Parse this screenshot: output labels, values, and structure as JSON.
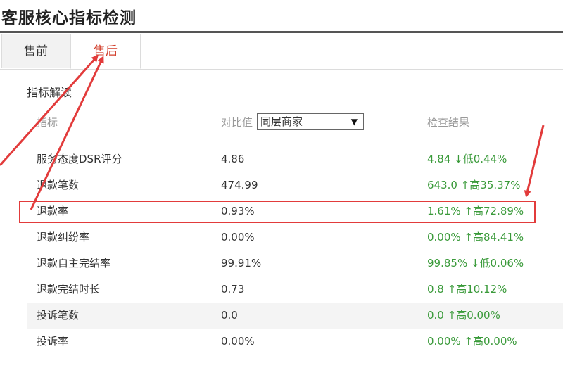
{
  "page": {
    "title": "客服核心指标检测"
  },
  "tabs": [
    {
      "label": "售前",
      "active": false
    },
    {
      "label": "售后",
      "active": true
    }
  ],
  "section": {
    "title": "指标解读",
    "headers": {
      "metric": "指标",
      "compare": "对比值",
      "result": "检查结果"
    },
    "compare_select": {
      "selected": "同层商家"
    }
  },
  "rows": [
    {
      "metric": "服务态度DSR评分",
      "value": "4.86",
      "result": "4.84 ↓低0.44%"
    },
    {
      "metric": "退款笔数",
      "value": "474.99",
      "result": "643.0 ↑高35.37%"
    },
    {
      "metric": "退款率",
      "value": "0.93%",
      "result": "1.61% ↑高72.89%"
    },
    {
      "metric": "退款纠纷率",
      "value": "0.00%",
      "result": "0.00% ↑高84.41%"
    },
    {
      "metric": "退款自主完结率",
      "value": "99.91%",
      "result": "99.85% ↓低0.06%"
    },
    {
      "metric": "退款完结时长",
      "value": "0.73",
      "result": "0.8 ↑高10.12%"
    },
    {
      "metric": "投诉笔数",
      "value": "0.0",
      "result": "0.0 ↑高0.00%"
    },
    {
      "metric": "投诉率",
      "value": "0.00%",
      "result": "0.00% ↑高0.00%"
    }
  ],
  "colors": {
    "active_tab": "#d23d2a",
    "result_text": "#3a9a3a",
    "annotation": "#e23b3b"
  }
}
